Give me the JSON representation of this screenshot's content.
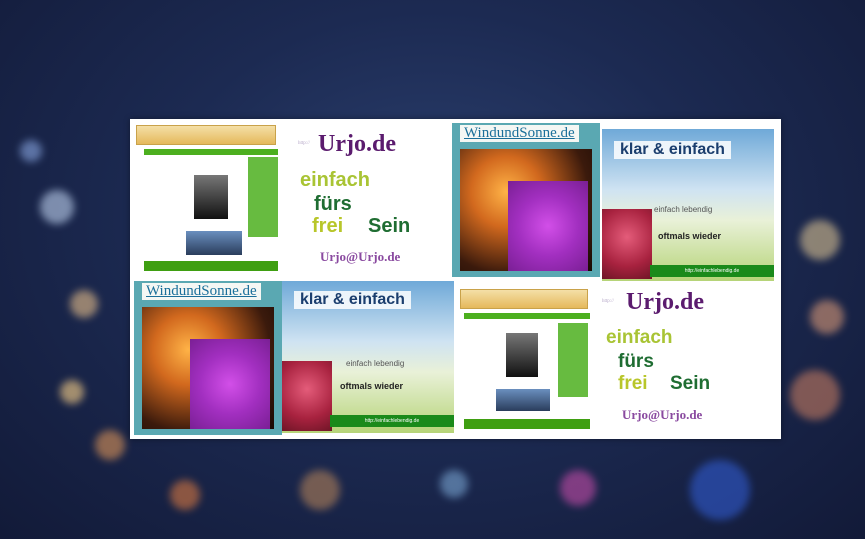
{
  "scene": {
    "description_free": true
  },
  "collage": {
    "tile_urjo": {
      "title": "Urjo.de",
      "words": [
        "einfach",
        "fürs",
        "frei",
        "Sein"
      ],
      "email": "Urjo@Urjo.de"
    },
    "tile_wind": {
      "title": "WindundSonne.de"
    },
    "tile_klar": {
      "title": "klar  &  einfach",
      "line1": "einfach  lebendig",
      "line2": "oftmals  wieder",
      "footer": "http://einfachlebendig.de"
    }
  },
  "colors": {
    "background": "#1c2a52",
    "urjo_purple": "#5b1b6e",
    "green_dark": "#1f6d32",
    "green_light": "#a9c434",
    "link_blue": "#1a6f9a"
  }
}
